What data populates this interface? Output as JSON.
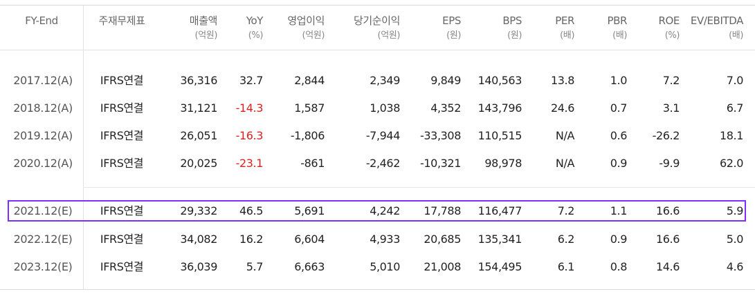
{
  "header": {
    "fy_end": "FY-End",
    "statement": "주재무제표",
    "revenue": {
      "label": "매출액",
      "unit": "(억원)"
    },
    "yoy": {
      "label": "YoY",
      "unit": "(%)"
    },
    "op_income": {
      "label": "영업이익",
      "unit": "(억원)"
    },
    "net_income": {
      "label": "당기순이익",
      "unit": "(억원)"
    },
    "eps": {
      "label": "EPS",
      "unit": "(원)"
    },
    "bps": {
      "label": "BPS",
      "unit": "(원)"
    },
    "per": {
      "label": "PER",
      "unit": "(배)"
    },
    "pbr": {
      "label": "PBR",
      "unit": "(배)"
    },
    "roe": {
      "label": "ROE",
      "unit": "(%)"
    },
    "ev_ebitda": {
      "label": "EV/EBITDA",
      "unit": "(배)"
    }
  },
  "rows": [
    {
      "fy": "2017.12(A)",
      "statement": "IFRS연결",
      "revenue": "36,316",
      "yoy": "32.7",
      "op_income": "2,844",
      "net_income": "2,349",
      "eps": "9,849",
      "bps": "140,563",
      "per": "13.8",
      "pbr": "1.0",
      "roe": "7.2",
      "ev_ebitda": "7.0"
    },
    {
      "fy": "2018.12(A)",
      "statement": "IFRS연결",
      "revenue": "31,121",
      "yoy": "-14.3",
      "op_income": "1,587",
      "net_income": "1,038",
      "eps": "4,352",
      "bps": "143,796",
      "per": "24.6",
      "pbr": "0.7",
      "roe": "3.1",
      "ev_ebitda": "6.7"
    },
    {
      "fy": "2019.12(A)",
      "statement": "IFRS연결",
      "revenue": "26,051",
      "yoy": "-16.3",
      "op_income": "-1,806",
      "net_income": "-7,944",
      "eps": "-33,308",
      "bps": "110,515",
      "per": "N/A",
      "pbr": "0.6",
      "roe": "-26.2",
      "ev_ebitda": "18.1"
    },
    {
      "fy": "2020.12(A)",
      "statement": "IFRS연결",
      "revenue": "20,025",
      "yoy": "-23.1",
      "op_income": "-861",
      "net_income": "-2,462",
      "eps": "-10,321",
      "bps": "98,978",
      "per": "N/A",
      "pbr": "0.9",
      "roe": "-9.9",
      "ev_ebitda": "62.0"
    },
    {
      "fy": "2021.12(E)",
      "statement": "IFRS연결",
      "revenue": "29,332",
      "yoy": "46.5",
      "op_income": "5,691",
      "net_income": "4,242",
      "eps": "17,788",
      "bps": "116,477",
      "per": "7.2",
      "pbr": "1.1",
      "roe": "16.6",
      "ev_ebitda": "5.9"
    },
    {
      "fy": "2022.12(E)",
      "statement": "IFRS연결",
      "revenue": "34,082",
      "yoy": "16.2",
      "op_income": "6,604",
      "net_income": "4,933",
      "eps": "20,685",
      "bps": "135,341",
      "per": "6.2",
      "pbr": "0.9",
      "roe": "16.6",
      "ev_ebitda": "5.0"
    },
    {
      "fy": "2023.12(E)",
      "statement": "IFRS연결",
      "revenue": "36,039",
      "yoy": "5.7",
      "op_income": "6,663",
      "net_income": "5,010",
      "eps": "21,008",
      "bps": "154,495",
      "per": "6.1",
      "pbr": "0.8",
      "roe": "14.6",
      "ev_ebitda": "4.6"
    }
  ],
  "colors": {
    "negative_yoy": "#e02020",
    "highlight_border": "#7b2ff7",
    "header_text": "#666666"
  }
}
